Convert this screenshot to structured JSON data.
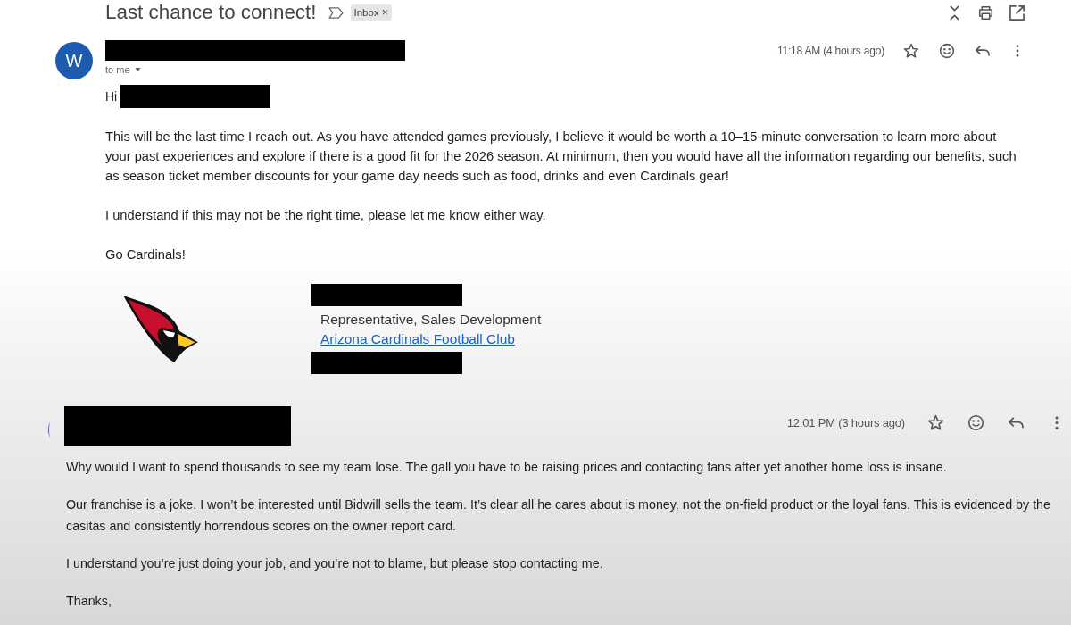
{
  "thread": {
    "subject": "Last chance to connect!",
    "important": false,
    "label": {
      "name": "Inbox",
      "remove": "×"
    }
  },
  "messages": [
    {
      "kind": "incoming",
      "avatar_letter": "W",
      "recipients": "to me",
      "time": "11:18 AM (4 hours ago)",
      "starred": false,
      "greeting": "Hi",
      "paragraphs": [
        "This will be the last time I reach out. As you have attended games previously, I believe it would be worth a 10–15-minute conversation to learn more about your past experiences and explore if there is a good fit for the 2026 season. At minimum, then you would have all the information regarding our benefits, such as season ticket member discounts for your game day needs such as food, drinks and even Cardinals gear!",
        "I understand if this may not be the right time, please let me know either way.",
        "Go Cardinals!"
      ],
      "signature": {
        "title": "Representative, Sales Development",
        "link": "Arizona Cardinals Football Club"
      }
    },
    {
      "kind": "reply",
      "time": "12:01 PM (3 hours ago)",
      "starred": false,
      "paragraphs": [
        "Why would I want to spend thousands to see my team lose. The gall you have to be raising prices and contacting fans after yet another home loss is insane.",
        "Our franchise is a joke. I won’t be interested until Bidwill sells the team. It’s clear all he cares about is money, not the on-field product or the loyal fans. This is evidenced by the casitas and consistently horrendous scores on the owner report card.",
        "I understand you’re just doing your job, and you’re not to blame, but please stop contacting me.",
        "Thanks,"
      ]
    }
  ]
}
